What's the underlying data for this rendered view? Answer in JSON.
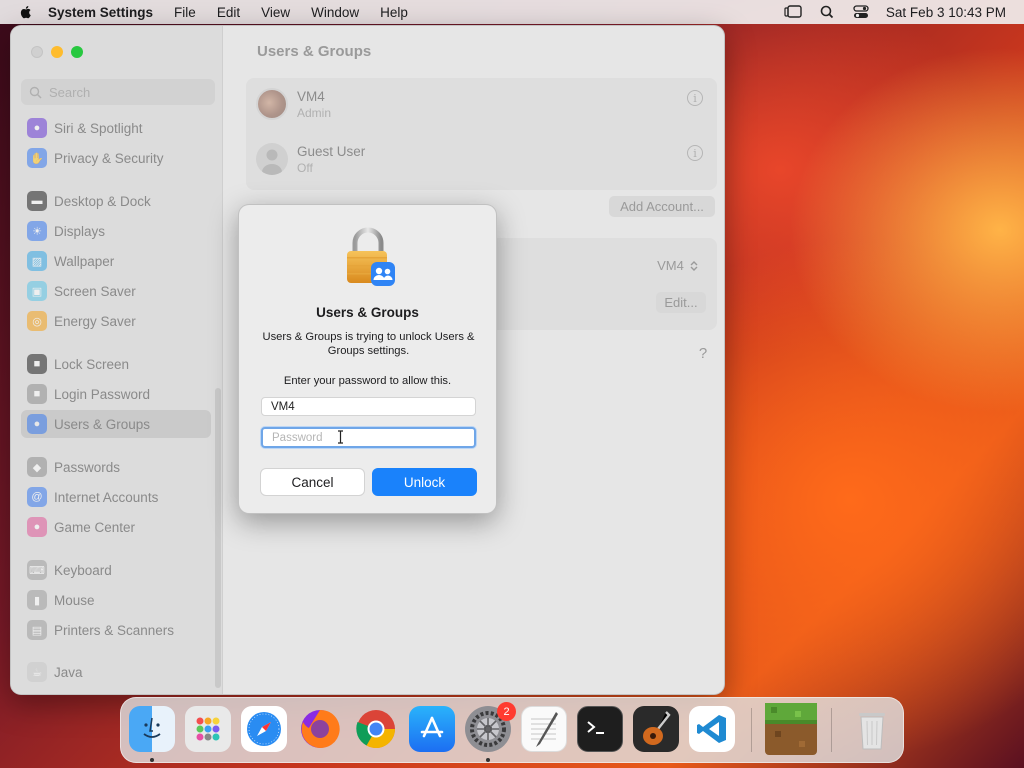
{
  "menubar": {
    "app_name": "System Settings",
    "items": [
      "File",
      "Edit",
      "View",
      "Window",
      "Help"
    ],
    "clock": "Sat Feb 3  10:43 PM"
  },
  "sidebar": {
    "search_placeholder": "Search",
    "items": [
      {
        "label": "Siri & Spotlight",
        "icon": "siri-icon",
        "color": "#6a3bd6"
      },
      {
        "label": "Privacy & Security",
        "icon": "hand-icon",
        "color": "#3a7bf0"
      },
      {
        "label": "Desktop & Dock",
        "icon": "dock-icon",
        "color": "#222222"
      },
      {
        "label": "Displays",
        "icon": "sun-icon",
        "color": "#3a7bf0"
      },
      {
        "label": "Wallpaper",
        "icon": "wallpaper-icon",
        "color": "#35a8e6"
      },
      {
        "label": "Screen Saver",
        "icon": "screen-saver-icon",
        "color": "#5cc6e8"
      },
      {
        "label": "Energy Saver",
        "icon": "bulb-icon",
        "color": "#f4a21c"
      },
      {
        "label": "Lock Screen",
        "icon": "lock-icon",
        "color": "#222222"
      },
      {
        "label": "Login Password",
        "icon": "lock-icon",
        "color": "#8e8e8e"
      },
      {
        "label": "Users & Groups",
        "icon": "users-icon",
        "color": "#3a7bf0"
      },
      {
        "label": "Passwords",
        "icon": "key-icon",
        "color": "#8e8e8e"
      },
      {
        "label": "Internet Accounts",
        "icon": "at-icon",
        "color": "#3a7bf0"
      },
      {
        "label": "Game Center",
        "icon": "game-center-icon",
        "color": "#e05a9a"
      },
      {
        "label": "Keyboard",
        "icon": "keyboard-icon",
        "color": "#a0a0a0"
      },
      {
        "label": "Mouse",
        "icon": "mouse-icon",
        "color": "#a0a0a0"
      },
      {
        "label": "Printers & Scanners",
        "icon": "printer-icon",
        "color": "#a0a0a0"
      },
      {
        "label": "Java",
        "icon": "java-icon",
        "color": "#c9c9c9"
      }
    ]
  },
  "main": {
    "title": "Users & Groups",
    "users": [
      {
        "name": "VM4",
        "role": "Admin"
      },
      {
        "name": "Guest User",
        "role": "Off"
      }
    ],
    "add_account": "Add Account...",
    "auto_login_value": "VM4",
    "edit": "Edit...",
    "help": "?"
  },
  "dialog": {
    "title": "Users & Groups",
    "message": "Users & Groups is trying to unlock Users & Groups settings.",
    "prompt": "Enter your password to allow this.",
    "username_value": "VM4",
    "password_placeholder": "Password",
    "cancel": "Cancel",
    "unlock": "Unlock"
  },
  "dock": {
    "settings_badge": "2"
  },
  "colors": {
    "accent": "#1a82fb",
    "focus_ring": "#6fa6e8"
  }
}
